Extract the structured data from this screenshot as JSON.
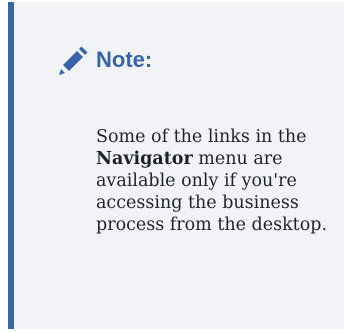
{
  "note": {
    "icon": "pencil-icon",
    "accent_color": "#3a63ab",
    "title": "Note:",
    "text_before": "Some of the links in the ",
    "emphasis": "Navigator",
    "text_after": " menu are available only if you're accessing the business process from the desktop."
  }
}
